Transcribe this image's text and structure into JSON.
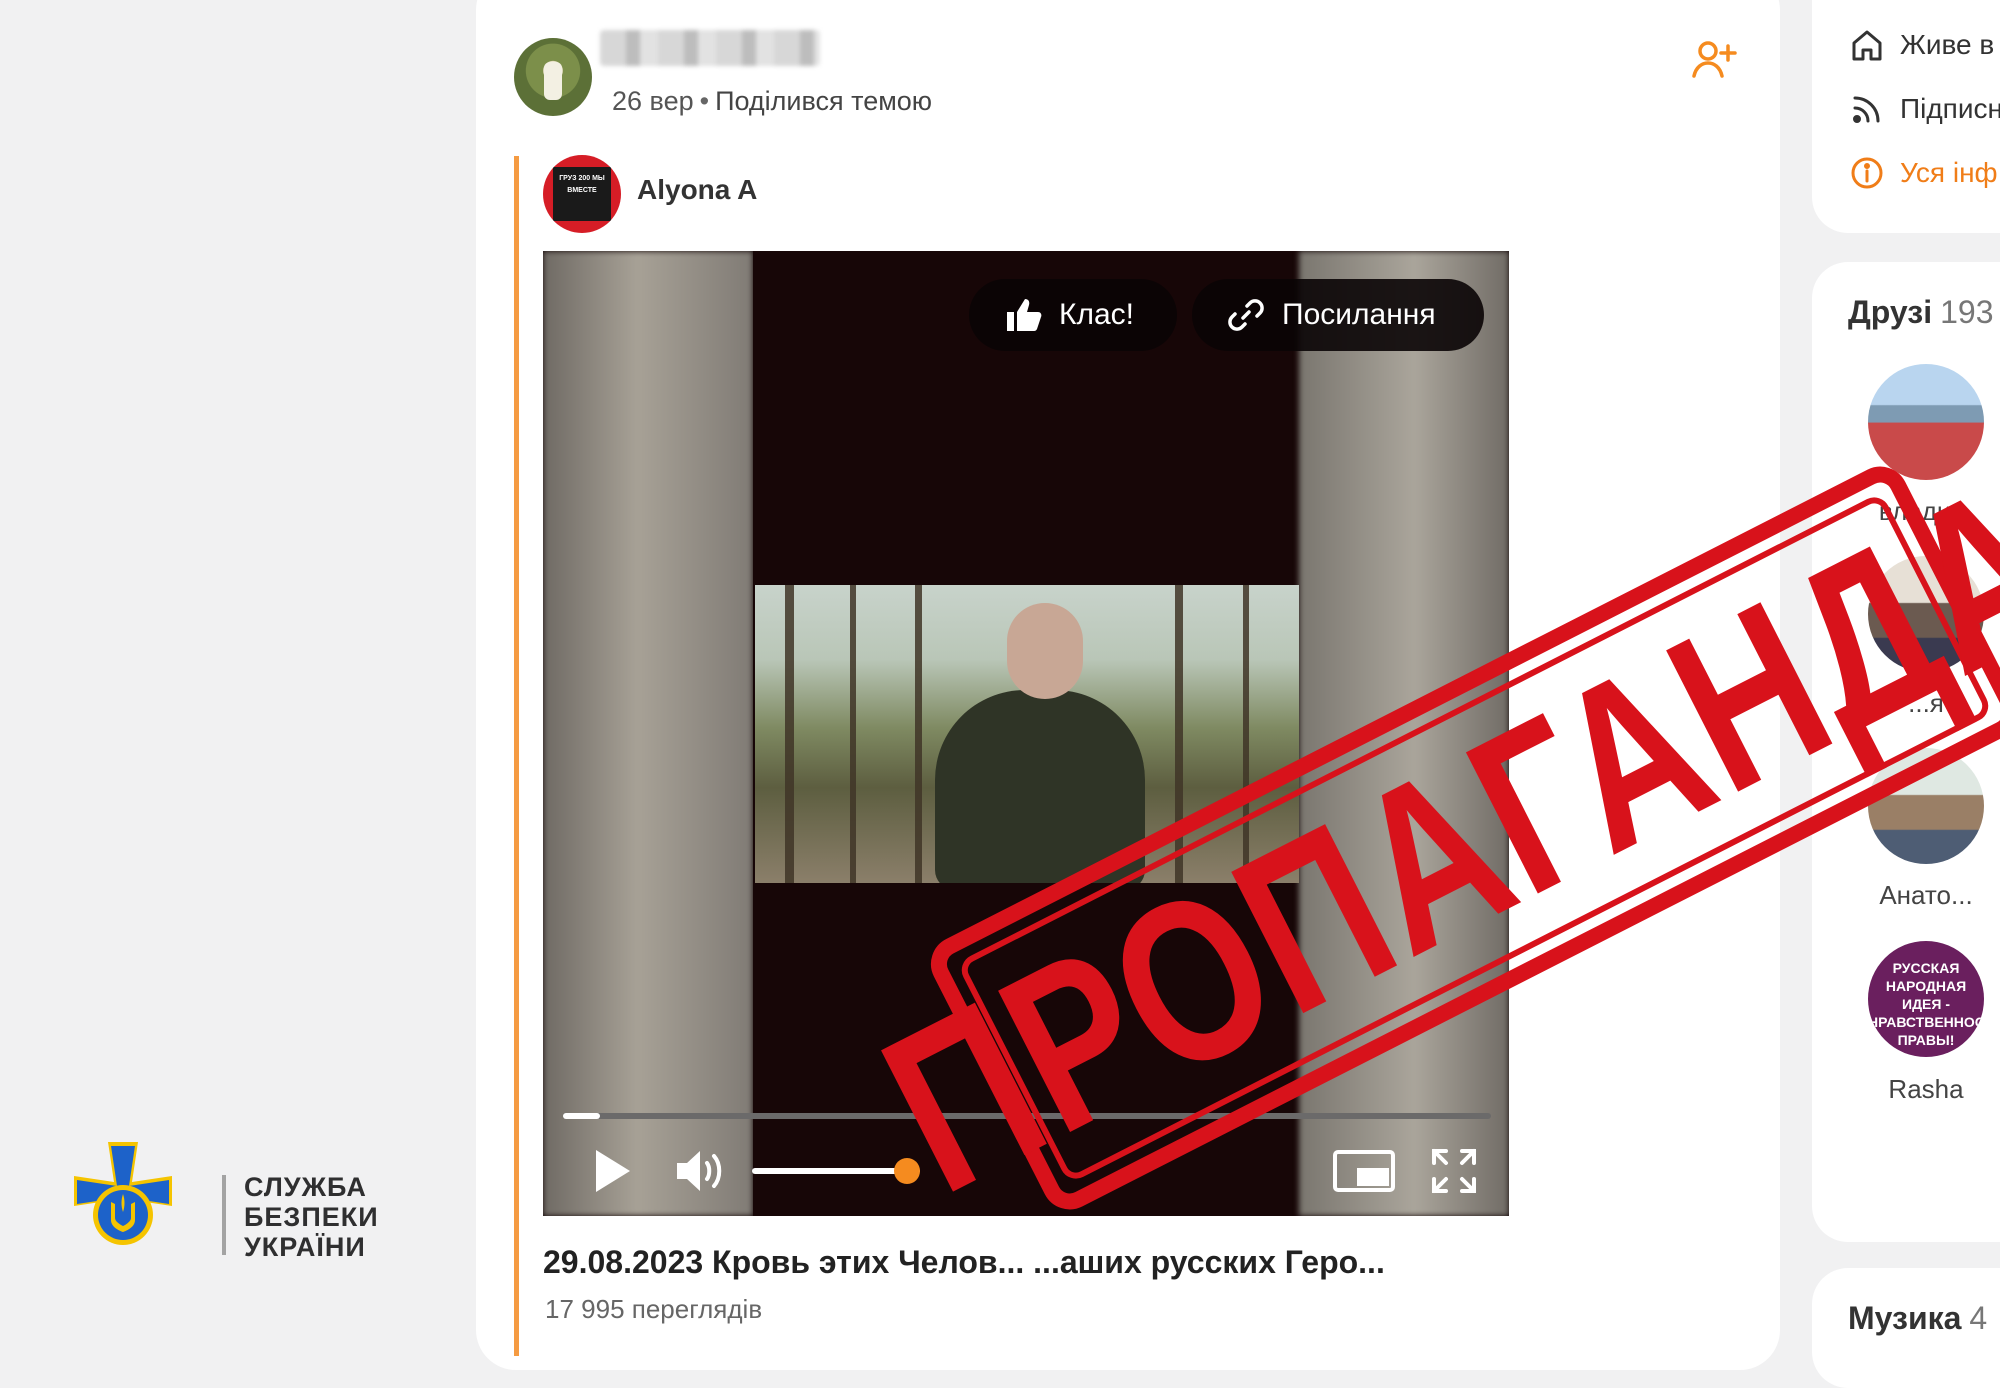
{
  "post": {
    "date": "26 вер",
    "action": "Поділився темою",
    "group_name": "Alyona A",
    "group_avatar_text": "ГРУЗ 200 МЫ ВМЕСТЕ"
  },
  "video": {
    "like_label": "Клас!",
    "link_label": "Посилання",
    "progress": 0.04,
    "volume": 0.92,
    "title": "29.08.2023 Кровь этих Челов... ...аших русских Геро...",
    "views": "17 995 переглядів"
  },
  "sidebar": {
    "items": [
      {
        "label": "Живе в",
        "icon": "home-icon"
      },
      {
        "label": "Підписн",
        "icon": "rss-icon"
      },
      {
        "label": "Уся інф",
        "icon": "info-icon",
        "color": "#f07d18"
      }
    ],
    "friends_title": "Друзі",
    "friends_count": "193",
    "friends": [
      {
        "name": "влади..."
      },
      {
        "name": "...я"
      },
      {
        "name": "Анато..."
      },
      {
        "name": "Rasha"
      }
    ],
    "rasha_avatar_text": "РУССКАЯ НАРОДНАЯ ИДЕЯ - НРАВСТВЕННОСТЬ, ПРАВЫ!",
    "music_title": "Музика",
    "music_count": "4"
  },
  "stamp": {
    "text": "ПРОПАГАНДА",
    "color": "#d8121b"
  },
  "logo": {
    "line1": "СЛУЖБА",
    "line2": "БЕЗПЕКИ",
    "line3": "УКРАЇНИ"
  },
  "colors": {
    "accent": "#f58b1f",
    "stamp": "#d8121b",
    "logo_blue": "#1d62c9",
    "logo_gold": "#f5c400"
  }
}
